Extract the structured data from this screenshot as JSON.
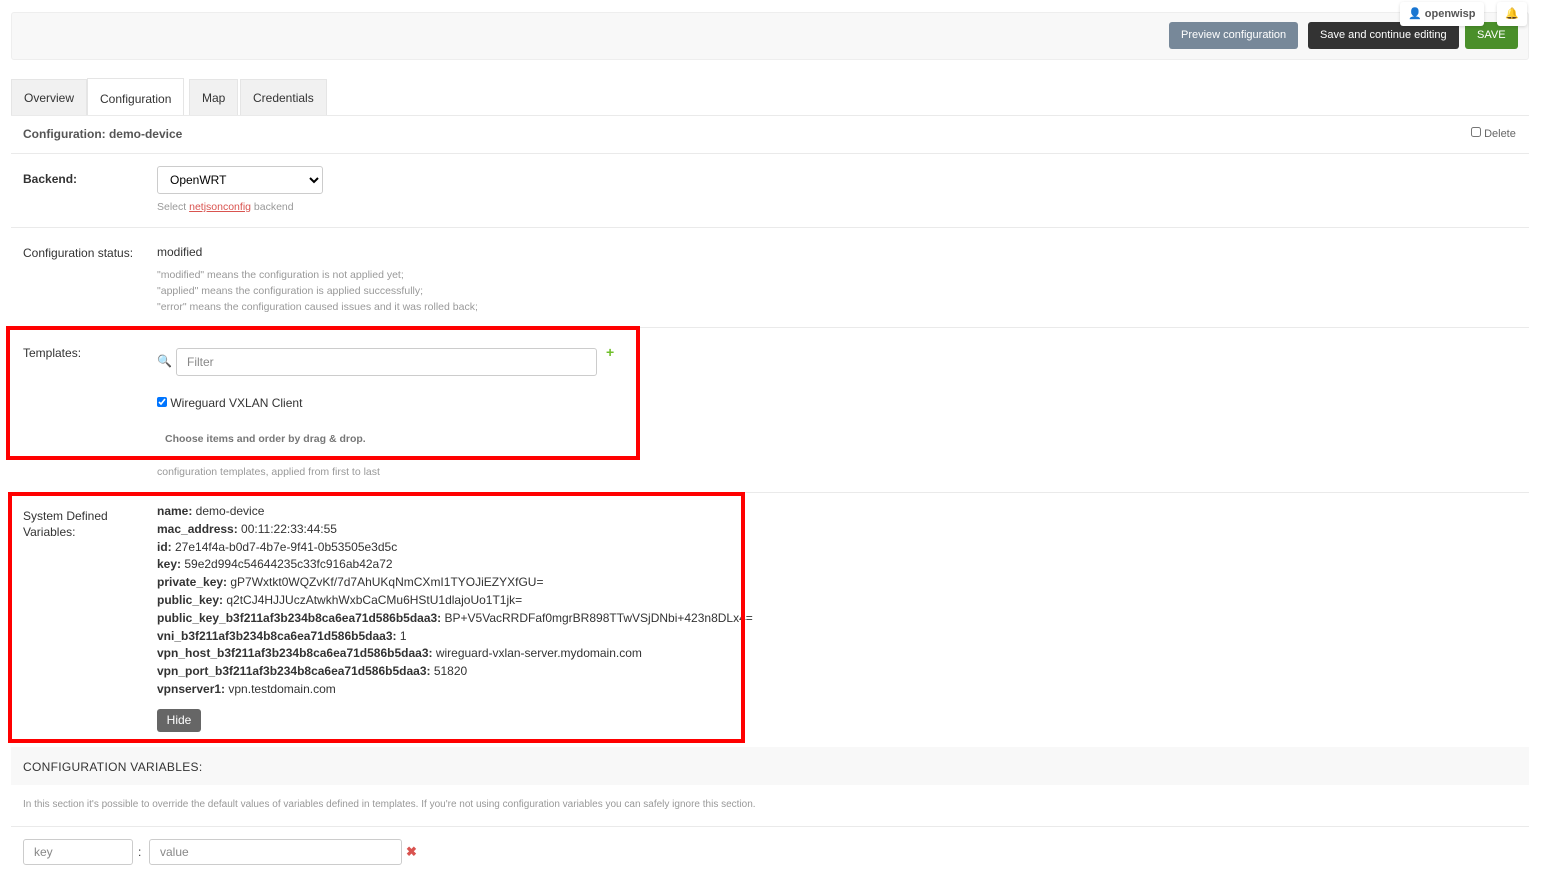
{
  "header": {
    "user": "openwisp",
    "preview_label": "Preview configuration",
    "save_continue_label": "Save and continue editing",
    "save_label": "SAVE",
    "colors": {
      "preview": "#778899",
      "save_continue": "#333333",
      "save": "#4a8f2a"
    }
  },
  "tabs": [
    {
      "label": "Overview"
    },
    {
      "label": "Configuration",
      "active": true
    },
    {
      "label": "Map"
    },
    {
      "label": "Credentials"
    }
  ],
  "config": {
    "title": "Configuration: demo-device",
    "delete_label": "Delete",
    "delete_checked": false
  },
  "backend": {
    "label": "Backend:",
    "value": "OpenWRT",
    "help_prefix": "Select ",
    "help_link": "netjsonconfig",
    "help_suffix": " backend"
  },
  "status": {
    "label": "Configuration status:",
    "value": "modified",
    "help": [
      "\"modified\" means the configuration is not applied yet;",
      "\"applied\" means the configuration is applied successfully;",
      "\"error\" means the configuration caused issues and it was rolled back;"
    ]
  },
  "templates": {
    "label": "Templates:",
    "filter_placeholder": "Filter",
    "items": [
      {
        "label": "Wireguard VXLAN Client",
        "checked": true
      }
    ],
    "drag_help": "Choose items and order by drag & drop.",
    "help": "configuration templates, applied from first to last"
  },
  "system_vars": {
    "label_line1": "System Defined",
    "label_line2": "Variables:",
    "items": [
      {
        "key": "name:",
        "value": " demo-device"
      },
      {
        "key": "mac_address:",
        "value": " 00:11:22:33:44:55"
      },
      {
        "key": "id:",
        "value": " 27e14f4a-b0d7-4b7e-9f41-0b53505e3d5c"
      },
      {
        "key": "key:",
        "value": " 59e2d994c54644235c33fc916ab42a72"
      },
      {
        "key": "private_key:",
        "value": " gP7Wxtkt0WQZvKf/7d7AhUKqNmCXmI1TYOJiEZYXfGU="
      },
      {
        "key": "public_key:",
        "value": " q2tCJ4HJJUczAtwkhWxbCaCMu6HStU1dlajoUo1T1jk="
      },
      {
        "key": "public_key_b3f211af3b234b8ca6ea71d586b5daa3:",
        "value": " BP+V5VacRRDFaf0mgrBR898TTwVSjDNbi+423n8DLx4="
      },
      {
        "key": "vni_b3f211af3b234b8ca6ea71d586b5daa3:",
        "value": " 1"
      },
      {
        "key": "vpn_host_b3f211af3b234b8ca6ea71d586b5daa3:",
        "value": " wireguard-vxlan-server.mydomain.com"
      },
      {
        "key": "vpn_port_b3f211af3b234b8ca6ea71d586b5daa3:",
        "value": " 51820"
      },
      {
        "key": "vpnserver1:",
        "value": " vpn.testdomain.com"
      }
    ],
    "hide_label": "Hide"
  },
  "config_vars": {
    "title": "CONFIGURATION VARIABLES:",
    "help": "In this section it's possible to override the default values of variables defined in templates. If you're not using configuration variables you can safely ignore this section.",
    "key_placeholder": "key",
    "value_placeholder": "value",
    "separator": ":"
  }
}
